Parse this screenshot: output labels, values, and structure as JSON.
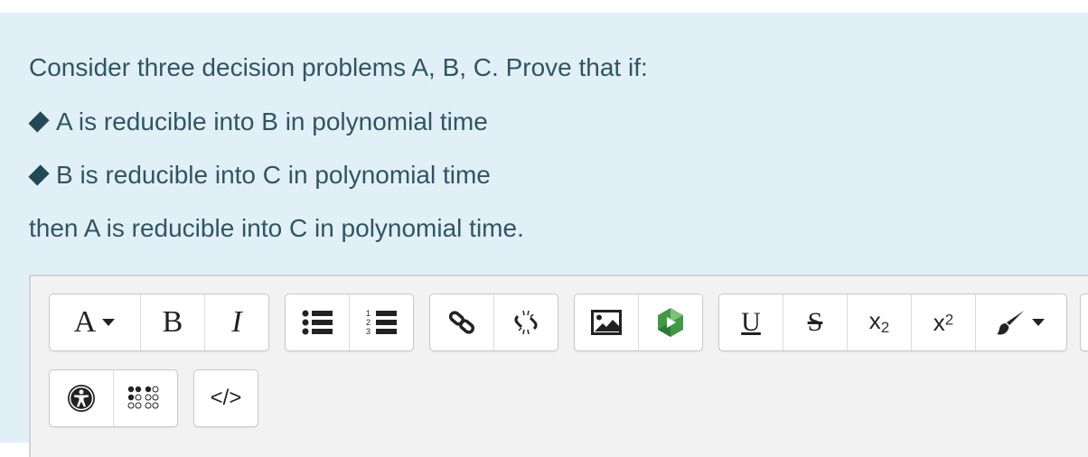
{
  "question": {
    "intro": "Consider three decision problems A, B, C. Prove that if:",
    "bullets": [
      "A is reducible into B in polynomial time",
      "B is reducible into C in polynomial time"
    ],
    "conclusion": "then A is reducible into C in polynomial time."
  },
  "toolbar": {
    "font_label": "A",
    "bold_label": "B",
    "italic_label": "I",
    "underline_label": "U",
    "strike_label": "S",
    "subscript_base": "x",
    "subscript_digit": "2",
    "superscript_base": "x",
    "superscript_digit": "2",
    "html_label": "</>"
  },
  "icons": [
    "font-dropdown-icon",
    "bold-icon",
    "italic-icon",
    "unordered-list-icon",
    "ordered-list-icon",
    "link-icon",
    "unlink-icon",
    "image-icon",
    "media-icon",
    "underline-icon",
    "strikethrough-icon",
    "subscript-icon",
    "superscript-icon",
    "paintbrush-icon",
    "accessibility-icon",
    "braille-icon",
    "html-code-icon"
  ],
  "colors": {
    "panel_bg": "#e1f0f7",
    "text": "#2f5564",
    "bullet": "#214a56",
    "media_green": "#3f9a45"
  }
}
